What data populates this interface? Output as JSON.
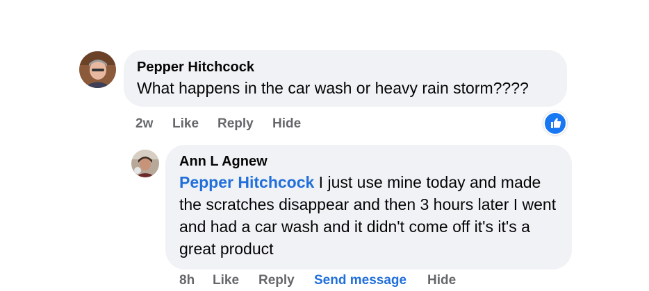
{
  "comments": [
    {
      "author": "Pepper Hitchcock",
      "text": "What happens in the car wash or heavy rain storm????",
      "actions": {
        "time": "2w",
        "like": "Like",
        "reply": "Reply",
        "hide": "Hide"
      },
      "reaction": "like-icon"
    },
    {
      "author": "Ann L Agnew",
      "mention": "Pepper Hitchcock",
      "text": " I just use mine today and made the scratches disappear and then 3 hours later I went and had a car wash and it didn't come off it's it's a great product",
      "actions": {
        "time": "8h",
        "like": "Like",
        "reply": "Reply",
        "send_message": "Send message",
        "hide": "Hide"
      }
    }
  ],
  "colors": {
    "bubble": "#f0f2f5",
    "mention": "#216fdb",
    "action_text": "#65676b",
    "reaction": "#1877f2"
  }
}
